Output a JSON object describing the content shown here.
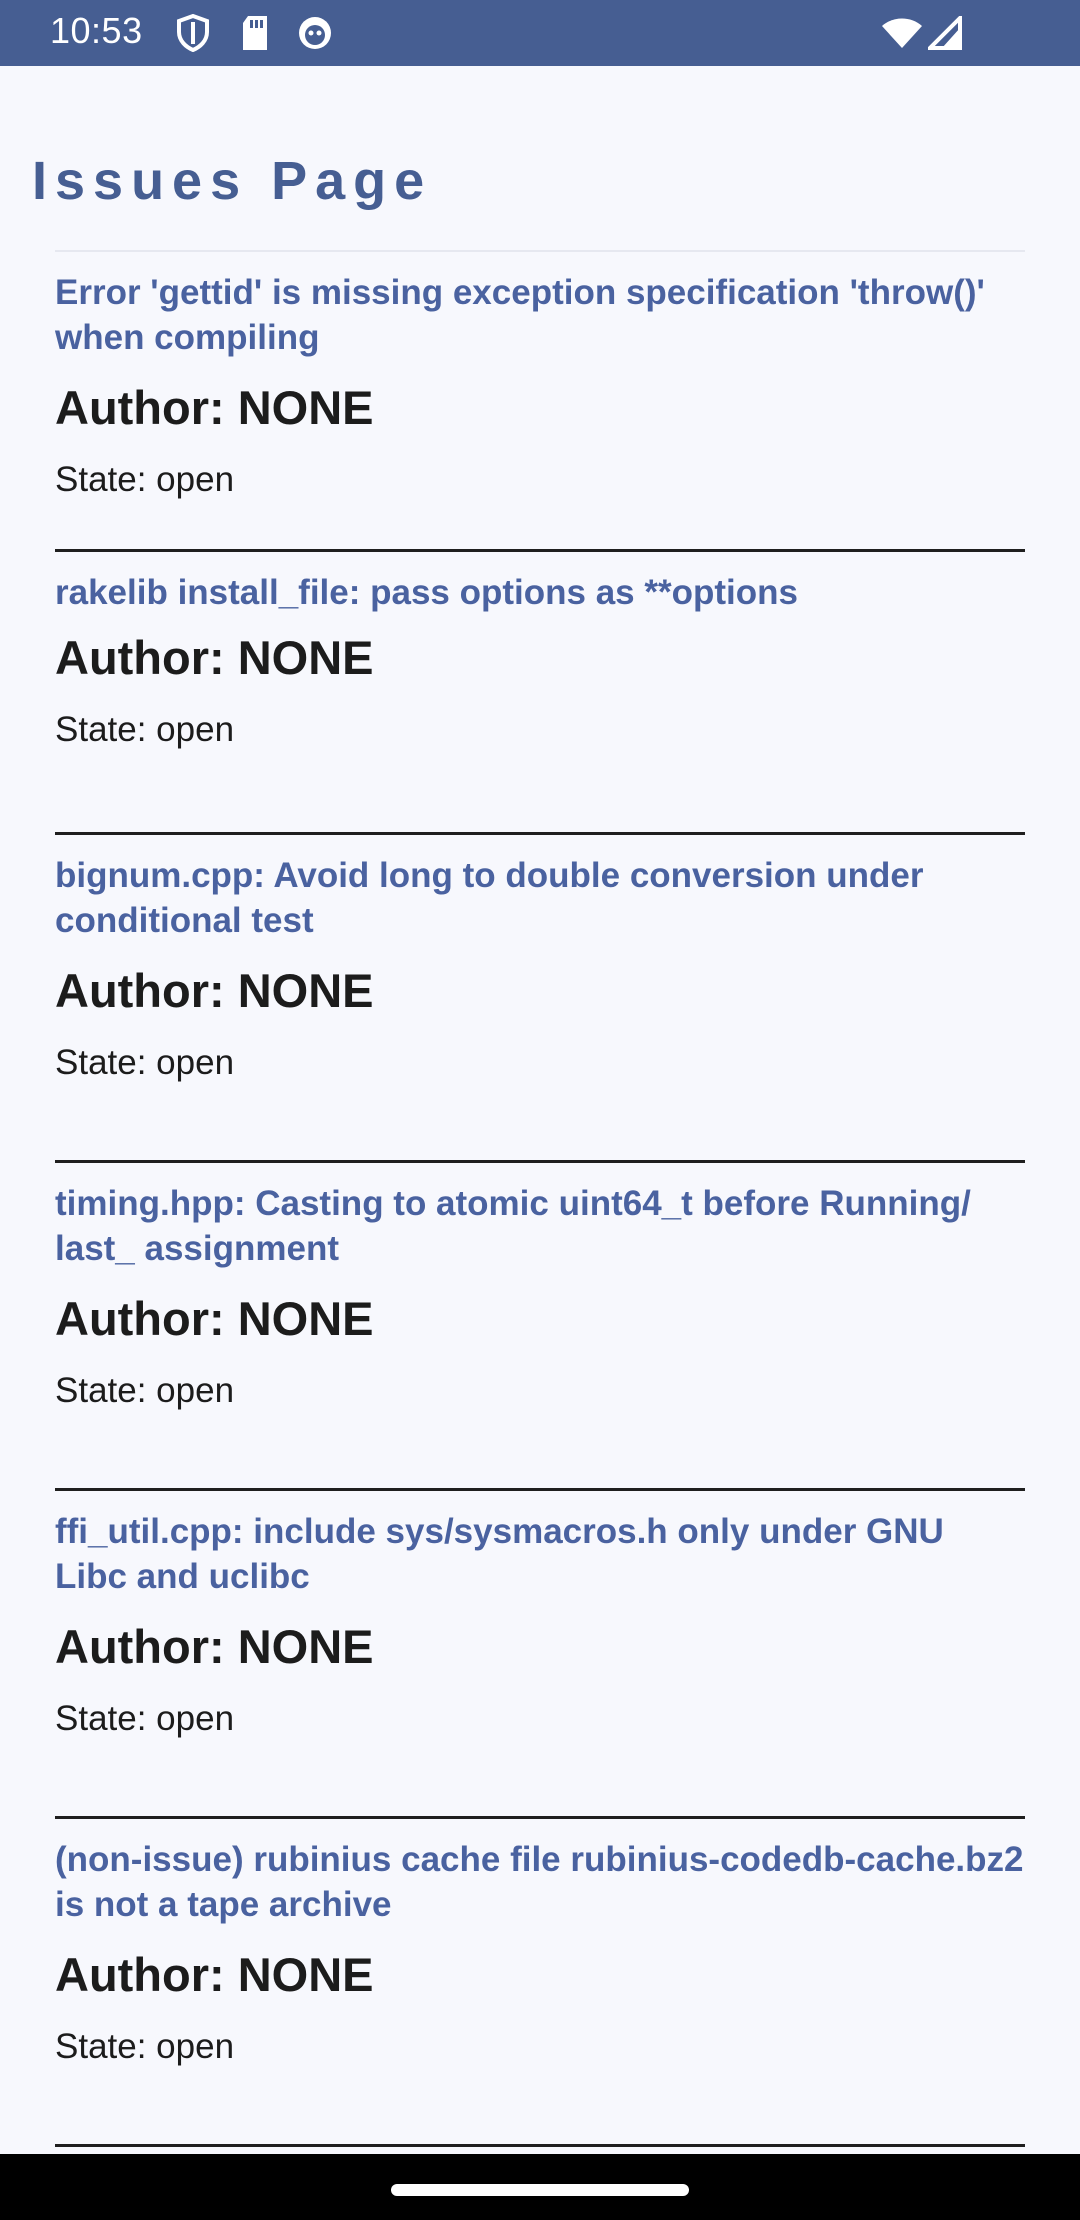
{
  "status_bar": {
    "time": "10:53",
    "icons_left": [
      "shield-icon",
      "sd-card-icon",
      "android-debug-icon"
    ],
    "icons_right": [
      "wifi-icon",
      "cell-signal-icon"
    ],
    "color": "#465e92"
  },
  "page": {
    "title": "Issues Page",
    "accent_color": "#465e92"
  },
  "issues": [
    {
      "title": "Error 'gettid' is missing exception specification 'throw()' when compiling",
      "author": "Author: NONE",
      "state": "State: open"
    },
    {
      "title": "rakelib install_file: pass options as **options",
      "author": "Author: NONE",
      "state": "State: open"
    },
    {
      "title": "bignum.cpp: Avoid long to double conversion under conditional test",
      "author": "Author: NONE",
      "state": "State: open"
    },
    {
      "title": "timing.hpp: Casting to atomic uint64_t before Running/ last_ assignment",
      "author": "Author: NONE",
      "state": "State: open"
    },
    {
      "title": "ffi_util.cpp: include sys/sysmacros.h only under GNU Libc and uclibc",
      "author": "Author: NONE",
      "state": "State: open"
    },
    {
      "title": "(non-issue) rubinius cache file rubinius-codedb-cache.bz2 is not a tape archive",
      "author": "Author: NONE",
      "state": "State: open"
    }
  ]
}
